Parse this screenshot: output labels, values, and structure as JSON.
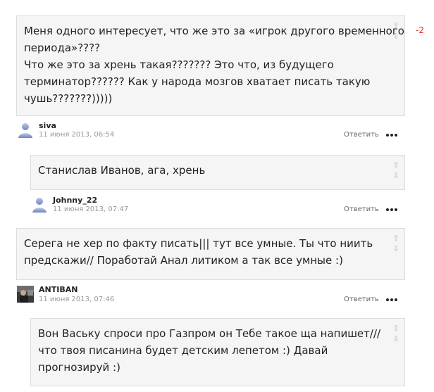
{
  "comments": [
    {
      "text": "Меня одного интересует, что же это за «игрок другого временного\nпериода»????\nЧто же это за хрень такая??????? Это что, из будущего\nтерминатор?????? Как у народа мозгов хватает писать такую\nчушь???????)))))",
      "score": "-2"
    },
    {
      "author": "siva",
      "date": "11 июня 2013, 06:54",
      "reply_label": "Ответить",
      "text": "Станислав Иванов, ага, хрень"
    },
    {
      "author": "Johnny_22",
      "date": "11 июня 2013, 07:47",
      "reply_label": "Ответить",
      "text": "Серега не хер по факту писать||| тут все умные. Ты что ниить\nпредскажи// Поработай Анал литиком а так все умные :)"
    },
    {
      "author": "ANTIBAN",
      "date": "11 июня 2013, 07:46",
      "reply_label": "Ответить",
      "text": "Вон Ваську спроси про Газпром он Тебе такое ща напишет///\nчто твоя писанина будет детским лепетом :) Давай\nпрогнозируй :)"
    }
  ],
  "icons": {
    "vote_up": "⇧",
    "vote_down": "⇩",
    "more": "more-dots-icon",
    "avatar_default": "user-silhouette-icon",
    "avatar_photo": "user-photo-avatar"
  },
  "colors": {
    "score_negative": "#e0302a",
    "bubble_bg": "#f5f5f5",
    "bubble_border": "#dcdcdc"
  }
}
